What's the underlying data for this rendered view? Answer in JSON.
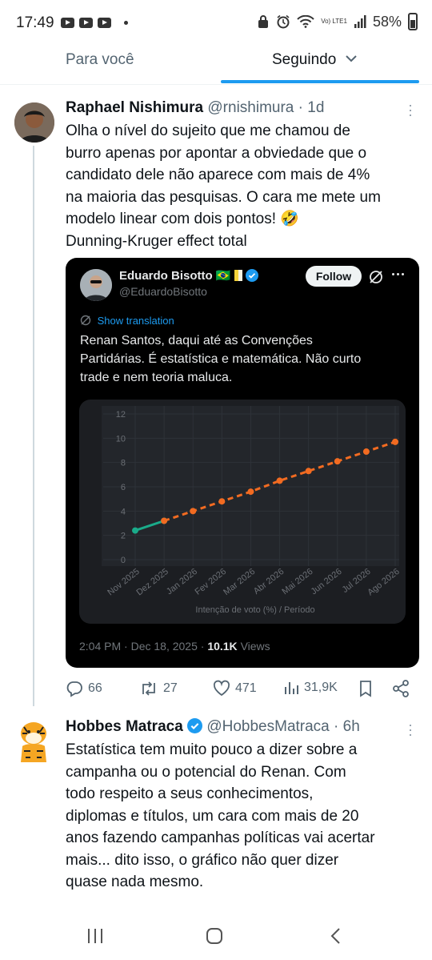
{
  "status_bar": {
    "time": "17:49",
    "battery": "58%",
    "network_label": "Vo) LTE1",
    "icons": [
      "youtube-icon",
      "youtube-icon",
      "youtube-icon",
      "dot-icon",
      "lock-icon",
      "alarm-icon",
      "wifi-icon",
      "signal-icon",
      "battery-icon"
    ]
  },
  "tabs": [
    {
      "label": "Para você",
      "active": false
    },
    {
      "label": "Seguindo",
      "active": true,
      "icon": "chevron-down-icon"
    }
  ],
  "colors": {
    "accent": "#1d9bf0",
    "text": "#0f1419",
    "muted": "#536471",
    "card_bg": "#000000",
    "series_actual": "#1aab8a",
    "series_projection": "#f26b21"
  },
  "tweet1": {
    "name": "Raphael Nishimura",
    "handle": "@rnishimura",
    "time": "· 1d",
    "lines": [
      "Olha o nível do sujeito que me chamou de",
      "burro apenas por apontar a obviedade que o",
      "candidato dele não aparece com mais de 4%",
      "na maioria das pesquisas. O cara me mete um",
      "modelo linear com dois pontos! 🤣",
      "Dunning-Kruger effect total"
    ],
    "quoted": {
      "name": "Eduardo Bisotto",
      "name_emoji": "🇧🇷",
      "handle": "@EduardoBisotto",
      "follow_label": "Follow",
      "show_translation": "Show translation",
      "lines": [
        "Renan Santos, daqui até as Convenções",
        "Partidárias. É estatística e matemática. Não curto",
        "trade e nem teoria maluca."
      ],
      "date": "2:04 PM · Dec 18, 2025 ·",
      "views_count": "10.1K",
      "views_label": "Views"
    },
    "actions": {
      "replies": "66",
      "reposts": "27",
      "likes": "471",
      "views": "31,9K"
    }
  },
  "tweet2": {
    "name": "Hobbes Matraca",
    "handle": "@HobbesMatraca",
    "time": "· 6h",
    "lines": [
      "Estatística tem muito pouco a dizer sobre a",
      "campanha ou o potencial do Renan.  Com",
      "todo respeito a seus conhecimentos,",
      "diplomas e títulos, um cara com mais de 20",
      "anos fazendo campanhas políticas vai acertar",
      "mais... dito isso, o gráfico não quer dizer",
      "quase nada mesmo."
    ]
  },
  "chart_data": {
    "type": "line",
    "categories": [
      "Nov 2025",
      "Dez 2025",
      "Jan 2026",
      "Fev 2026",
      "Mar 2026",
      "Abr 2026",
      "Mai 2026",
      "Jun 2026",
      "Jul 2026",
      "Ago 2026"
    ],
    "series": [
      {
        "values": [
          2.4,
          3.2,
          null,
          null,
          null,
          null,
          null,
          null,
          null,
          null
        ],
        "color": "#1aab8a",
        "style": "solid"
      },
      {
        "values": [
          null,
          3.2,
          4.0,
          4.8,
          5.6,
          6.5,
          7.3,
          8.1,
          8.9,
          9.7
        ],
        "color": "#f26b21",
        "style": "dashed"
      }
    ],
    "y_ticks": [
      "0",
      "2",
      "4",
      "6",
      "8",
      "10",
      "12"
    ],
    "ylim": [
      0,
      12
    ],
    "xlabel": "Intenção de voto (%) / Período",
    "ylabel": "",
    "grid": true,
    "legend": "none"
  }
}
